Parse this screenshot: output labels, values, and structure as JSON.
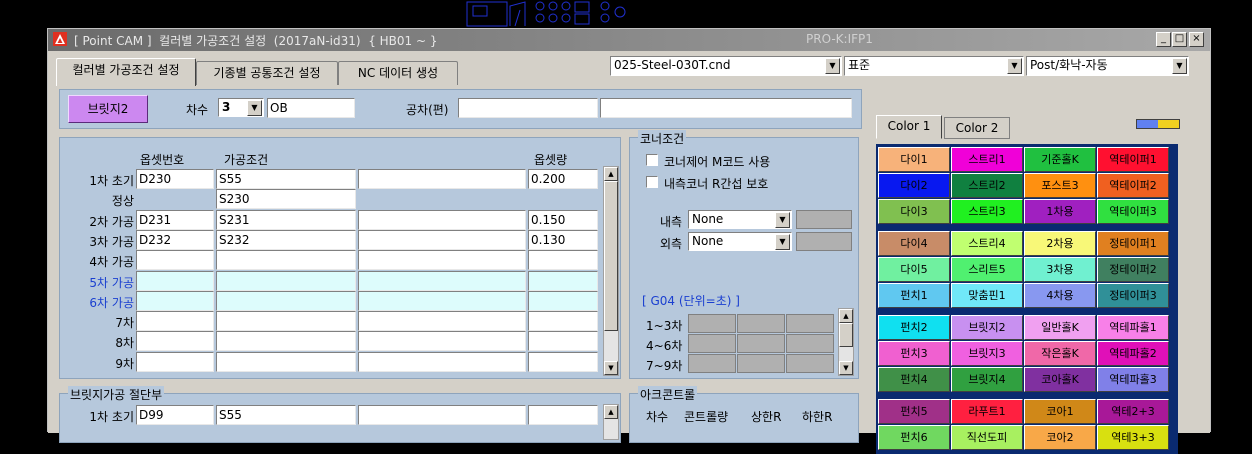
{
  "window": {
    "title": "[ Point CAM ]  컬러별 가공조건 설정  (2017aN-id31)  { HB01 ~ }",
    "right_title": "PRO-K:IFP1",
    "min_label": "_",
    "max_label": "□",
    "close_label": "×"
  },
  "tabs": [
    "컬러별 가공조건 설정",
    "기종별 공통조건 설정",
    "NC 데이터 생성"
  ],
  "toolbar": {
    "file_combo": "025-Steel-030T.cnd",
    "std_combo": "표준",
    "post_combo": "Post/화낙-자동"
  },
  "top_panel": {
    "bridge_button": "브릿지2",
    "chasu_label": "차수",
    "chasu_value": "3",
    "ob_value": "OB",
    "tolerance_label": "공차(편)",
    "tolerance_value1": "",
    "tolerance_value2": ""
  },
  "grid": {
    "headers": {
      "offset_no": "옵셋번호",
      "condition": "가공조건",
      "offset_amount": "옵셋량"
    },
    "rows": [
      {
        "label": "1차 초기",
        "offset": "D230",
        "cond": "S55",
        "extra": "",
        "amount": "0.200",
        "blue": false,
        "cyan": false
      },
      {
        "label": "정상",
        "offset": "",
        "cond": "S230",
        "extra": "",
        "amount": "",
        "blue": false,
        "cyan": false,
        "only_cond": true
      },
      {
        "label": "2차 가공",
        "offset": "D231",
        "cond": "S231",
        "extra": "",
        "amount": "0.150",
        "blue": false,
        "cyan": false
      },
      {
        "label": "3차 가공",
        "offset": "D232",
        "cond": "S232",
        "extra": "",
        "amount": "0.130",
        "blue": false,
        "cyan": false
      },
      {
        "label": "4차 가공",
        "offset": "",
        "cond": "",
        "extra": "",
        "amount": "",
        "blue": false,
        "cyan": false
      },
      {
        "label": "5차 가공",
        "offset": "",
        "cond": "",
        "extra": "",
        "amount": "",
        "blue": true,
        "cyan": true
      },
      {
        "label": "6차 가공",
        "offset": "",
        "cond": "",
        "extra": "",
        "amount": "",
        "blue": true,
        "cyan": true
      },
      {
        "label": "7차",
        "offset": "",
        "cond": "",
        "extra": "",
        "amount": "",
        "blue": false,
        "cyan": false
      },
      {
        "label": "8차",
        "offset": "",
        "cond": "",
        "extra": "",
        "amount": "",
        "blue": false,
        "cyan": false
      },
      {
        "label": "9차",
        "offset": "",
        "cond": "",
        "extra": "",
        "amount": "",
        "blue": false,
        "cyan": false
      }
    ]
  },
  "corner": {
    "legend": "코너조건",
    "check1": "코너제어 M코드 사용",
    "check2": "내측코너 R간섭 보호",
    "inner_label": "내측",
    "inner_value": "None",
    "outer_label": "외측",
    "outer_value": "None",
    "g04_label": "[  G04 (단위=초)  ]",
    "g04_rows": [
      "1~3차",
      "4~6차",
      "7~9차"
    ]
  },
  "bridge_section": {
    "legend": "브릿지가공 절단부",
    "row_label": "1차 초기",
    "offset": "D99",
    "cond": "S55"
  },
  "arc": {
    "legend": "아크콘트롤",
    "headers": [
      "차수",
      "콘트롤량",
      "상한R",
      "하한R"
    ]
  },
  "color_tabs": [
    "Color 1",
    "Color 2"
  ],
  "color_groups": [
    [
      [
        {
          "t": "다이1",
          "c": "#f7b27a"
        },
        {
          "t": "스트리1",
          "c": "#f000d8"
        },
        {
          "t": "기준홀K",
          "c": "#20c040"
        },
        {
          "t": "역테이퍼1",
          "c": "#ff1030"
        }
      ],
      [
        {
          "t": "다이2",
          "c": "#0818f0"
        },
        {
          "t": "스트리2",
          "c": "#108040"
        },
        {
          "t": "포스트3",
          "c": "#ff9010"
        },
        {
          "t": "역테이퍼2",
          "c": "#f06020"
        }
      ],
      [
        {
          "t": "다이3",
          "c": "#80c050"
        },
        {
          "t": "스트리3",
          "c": "#20f020"
        },
        {
          "t": "1차용",
          "c": "#a020c0"
        },
        {
          "t": "역테이퍼3",
          "c": "#30e040"
        }
      ]
    ],
    [
      [
        {
          "t": "다이4",
          "c": "#c88c68"
        },
        {
          "t": "스트리4",
          "c": "#c0ff70"
        },
        {
          "t": "2차용",
          "c": "#f8f878"
        },
        {
          "t": "정테이퍼1",
          "c": "#e08020"
        }
      ],
      [
        {
          "t": "다이5",
          "c": "#70f0a0"
        },
        {
          "t": "스리트5",
          "c": "#50f070"
        },
        {
          "t": "3차용",
          "c": "#70f0d0"
        },
        {
          "t": "정테이퍼2",
          "c": "#408060"
        }
      ],
      [
        {
          "t": "펀치1",
          "c": "#60c8f0"
        },
        {
          "t": "맞춤핀1",
          "c": "#70e8f8"
        },
        {
          "t": "4차용",
          "c": "#8898f0"
        },
        {
          "t": "정테이퍼3",
          "c": "#309098"
        }
      ]
    ],
    [
      [
        {
          "t": "펀치2",
          "c": "#10e0f0"
        },
        {
          "t": "브릿지2",
          "c": "#c890f0"
        },
        {
          "t": "일반홀K",
          "c": "#f0a0f0"
        },
        {
          "t": "역테파홀1",
          "c": "#f880e8"
        }
      ],
      [
        {
          "t": "펀치3",
          "c": "#f060d0"
        },
        {
          "t": "브릿지3",
          "c": "#f060e0"
        },
        {
          "t": "작은홀K",
          "c": "#f068a8"
        },
        {
          "t": "역테파홀2",
          "c": "#e010b8"
        }
      ],
      [
        {
          "t": "펀치4",
          "c": "#409048"
        },
        {
          "t": "브릿지4",
          "c": "#30a040"
        },
        {
          "t": "코아홀K",
          "c": "#8030a0"
        },
        {
          "t": "역테파홀3",
          "c": "#8080e8"
        }
      ]
    ],
    [
      [
        {
          "t": "펀치5",
          "c": "#a03088"
        },
        {
          "t": "라푸트1",
          "c": "#ff2040"
        },
        {
          "t": "코아1",
          "c": "#d08818"
        },
        {
          "t": "역테2+3",
          "c": "#a81898"
        }
      ],
      [
        {
          "t": "펀치6",
          "c": "#70d860"
        },
        {
          "t": "직선도피",
          "c": "#a8f060"
        },
        {
          "t": "코아2",
          "c": "#f8a848"
        },
        {
          "t": "역테3+3",
          "c": "#d8e010"
        }
      ]
    ]
  ],
  "colors": {
    "window_blue": "#0a2a70",
    "panel_blue": "#b6c8dc",
    "cyan_row": "#ddfcfc",
    "face": "#d4d0c8"
  }
}
